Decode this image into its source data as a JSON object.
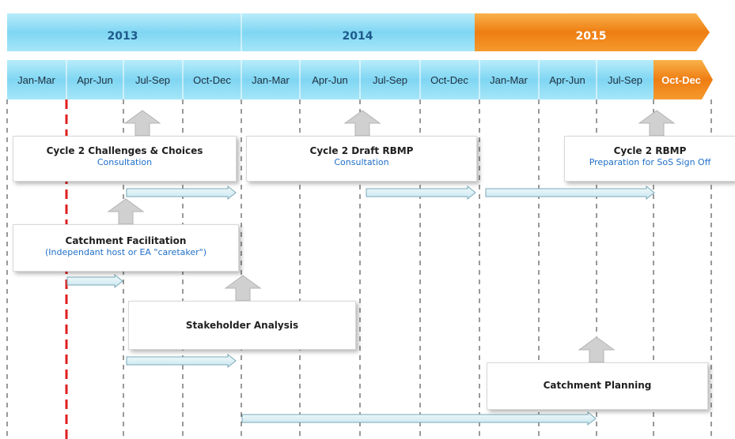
{
  "years": [
    {
      "label": "2013",
      "color": "#7fd4f0"
    },
    {
      "label": "2014",
      "color": "#7fd4f0"
    },
    {
      "label": "2015",
      "color": "#f28a1e"
    }
  ],
  "quarters": [
    "Jan-Mar",
    "Apr-Jun",
    "Jul-Sep",
    "Oct-Dec",
    "Jan-Mar",
    "Apr-Jun",
    "Jul-Sep",
    "Oct-Dec",
    "Jan-Mar",
    "Apr-Jun",
    "Jul-Sep",
    "Oct-Dec"
  ],
  "colors": {
    "blue_bar": "#8fdcf5",
    "orange_bar": "#f28a1e",
    "current_marker": "#e01e1e",
    "arrow_fill": "#dceef3",
    "arrow_stroke": "#7aa9b8",
    "up_arrow": "#c9c9c9"
  },
  "boxes": {
    "challenges": {
      "title": "Cycle 2 Challenges & Choices",
      "subtitle": "Consultation"
    },
    "draft_rbmp": {
      "title": "Cycle 2 Draft  RBMP",
      "subtitle": "Consultation"
    },
    "rbmp": {
      "title": "Cycle 2 RBMP",
      "subtitle": "Preparation for SoS Sign Off"
    },
    "catchment_facilitation": {
      "title": "Catchment Facilitation",
      "subtitle": "(Independant  host  or EA \"caretaker\")"
    },
    "stakeholder_analysis": {
      "title": "Stakeholder  Analysis"
    },
    "catchment_planning": {
      "title": "Catchment Planning"
    }
  }
}
